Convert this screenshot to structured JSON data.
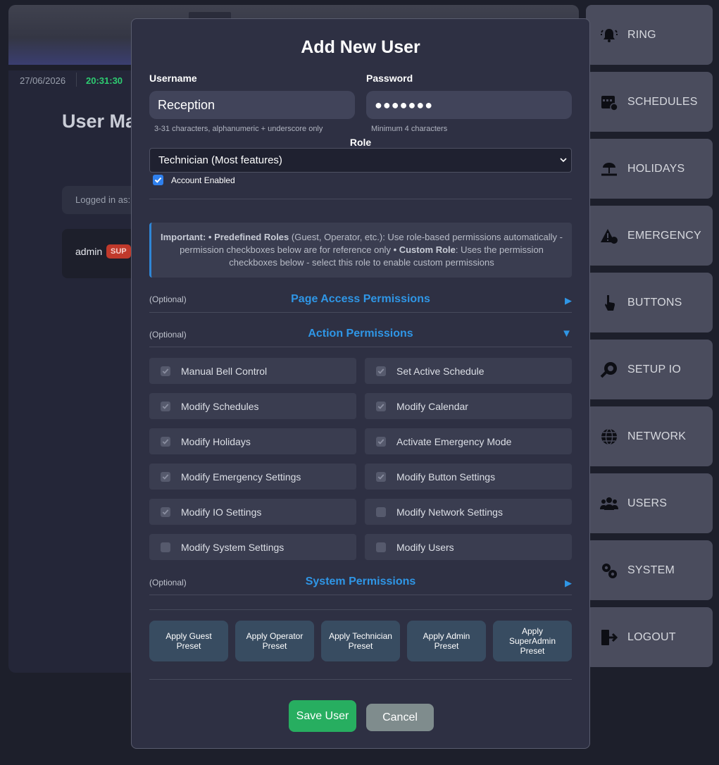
{
  "background": {
    "date": "27/06/2026",
    "time": "20:31:30",
    "page_title": "User Ma",
    "logged_in_text": "Logged in as:",
    "user_row": {
      "name": "admin",
      "badge": "SUP"
    }
  },
  "sidebar": {
    "items": [
      {
        "label": "RING",
        "icon": "bell-icon"
      },
      {
        "label": "SCHEDULES",
        "icon": "calendar-icon"
      },
      {
        "label": "HOLIDAYS",
        "icon": "beach-icon"
      },
      {
        "label": "EMERGENCY",
        "icon": "warning-icon"
      },
      {
        "label": "BUTTONS",
        "icon": "pointer-icon"
      },
      {
        "label": "SETUP IO",
        "icon": "wrench-icon"
      },
      {
        "label": "NETWORK",
        "icon": "globe-icon"
      },
      {
        "label": "USERS",
        "icon": "users-icon"
      },
      {
        "label": "SYSTEM",
        "icon": "gears-icon"
      },
      {
        "label": "LOGOUT",
        "icon": "logout-icon"
      }
    ]
  },
  "modal": {
    "title": "Add New User",
    "username": {
      "label": "Username",
      "value": "Reception",
      "hint": "3-31 characters, alphanumeric + underscore only"
    },
    "password": {
      "label": "Password",
      "value": "●●●●●●●",
      "hint": "Minimum 4 characters"
    },
    "role": {
      "label": "Role",
      "selected": "Technician (Most features)"
    },
    "account_enabled": {
      "label": "Account Enabled",
      "checked": true
    },
    "info": {
      "important": "Important:",
      "bullet1_bold": "• Predefined Roles",
      "bullet1_text": " (Guest, Operator, etc.): Use role-based permissions automatically - permission checkboxes below are for reference only ",
      "bullet2_bold": "• Custom Role",
      "bullet2_text": ": Uses the permission checkboxes below - select this role to enable custom permissions"
    },
    "sections": {
      "page_access": {
        "optional": "(Optional)",
        "title": "Page Access Permissions",
        "arrow": "▶"
      },
      "action": {
        "optional": "(Optional)",
        "title": "Action Permissions",
        "arrow": "▼"
      },
      "system": {
        "optional": "(Optional)",
        "title": "System Permissions",
        "arrow": "▶"
      }
    },
    "action_permissions": [
      {
        "label": "Manual Bell Control",
        "checked": true
      },
      {
        "label": "Set Active Schedule",
        "checked": true
      },
      {
        "label": "Modify Schedules",
        "checked": true
      },
      {
        "label": "Modify Calendar",
        "checked": true
      },
      {
        "label": "Modify Holidays",
        "checked": true
      },
      {
        "label": "Activate Emergency Mode",
        "checked": true
      },
      {
        "label": "Modify Emergency Settings",
        "checked": true
      },
      {
        "label": "Modify Button Settings",
        "checked": true
      },
      {
        "label": "Modify IO Settings",
        "checked": true
      },
      {
        "label": "Modify Network Settings",
        "checked": false
      },
      {
        "label": "Modify System Settings",
        "checked": false
      },
      {
        "label": "Modify Users",
        "checked": false
      }
    ],
    "presets": [
      "Apply Guest Preset",
      "Apply Operator Preset",
      "Apply Technician Preset",
      "Apply Admin Preset",
      "Apply SuperAdmin Preset"
    ],
    "save_label": "Save User",
    "cancel_label": "Cancel"
  },
  "colors": {
    "accent_blue": "#2f96e6",
    "save_green": "#27ae60",
    "cancel_gray": "#7f8c8d",
    "badge_red": "#c0392b",
    "time_green": "#2ecc71"
  }
}
